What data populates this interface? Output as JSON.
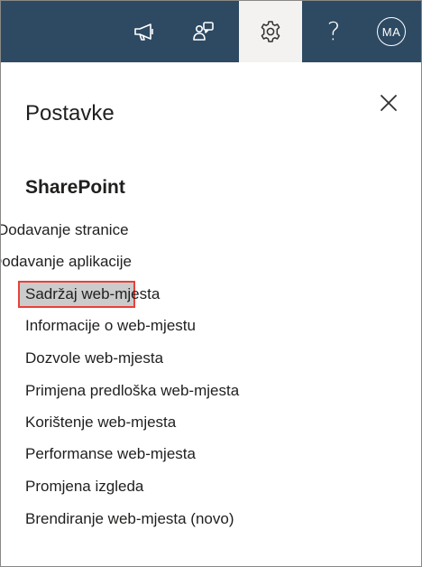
{
  "topbar": {
    "icons": [
      "megaphone-icon",
      "feedback-icon",
      "gear-icon",
      "help-icon"
    ],
    "help_glyph": "?",
    "avatar_initials": "MA"
  },
  "panel": {
    "title": "Postavke",
    "section_title": "SharePoint",
    "items": [
      {
        "label": "Dodavanje stranice"
      },
      {
        "label": "Dodavanje aplikacije"
      },
      {
        "label": "Sadržaj web-mjesta"
      },
      {
        "label": "Informacije o web-mjestu"
      },
      {
        "label": "Dozvole web-mjesta"
      },
      {
        "label": "Primjena predloška web-mjesta"
      },
      {
        "label": "Korištenje web-mjesta"
      },
      {
        "label": "Performanse web-mjesta"
      },
      {
        "label": "Promjena izgleda"
      },
      {
        "label": "Brendiranje web-mjesta (novo)"
      }
    ]
  },
  "colors": {
    "header_bg": "#2e4a63",
    "highlight_border": "#e8413a"
  }
}
